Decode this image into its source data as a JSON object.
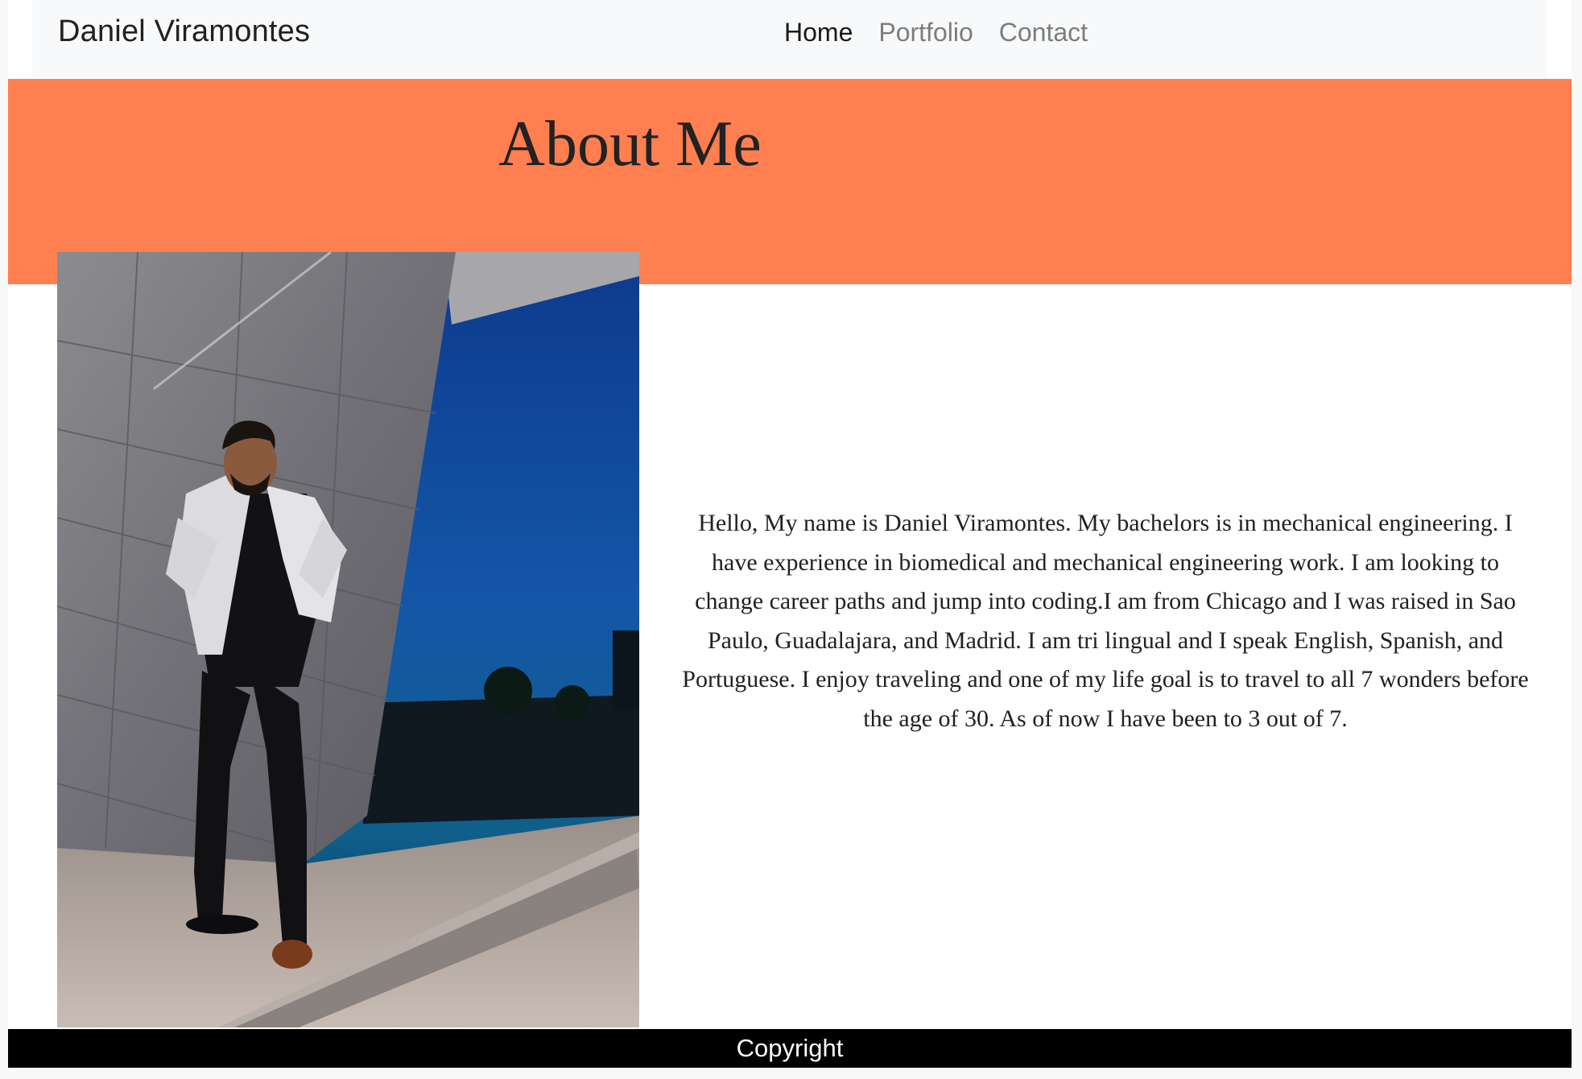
{
  "navbar": {
    "brand": "Daniel Viramontes",
    "links": [
      {
        "label": "Home",
        "active": true
      },
      {
        "label": "Portfolio",
        "active": false
      },
      {
        "label": "Contact",
        "active": false
      }
    ]
  },
  "hero": {
    "title": "About Me",
    "background": "#ff7f50"
  },
  "main": {
    "bio": "Hello, My name is Daniel Viramontes. My bachelors is in mechanical engineering. I have experience in biomedical and mechanical engineering work. I am looking to change career paths and jump into coding.I am from Chicago and I was raised in Sao Paulo, Guadalajara, and Madrid. I am tri lingual and I speak English, Spanish, and Portuguese. I enjoy traveling and one of my life goal is to travel to all 7 wonders before the age of 30. As of now I have been to 3 out of 7."
  },
  "footer": {
    "text": "Copyright"
  }
}
